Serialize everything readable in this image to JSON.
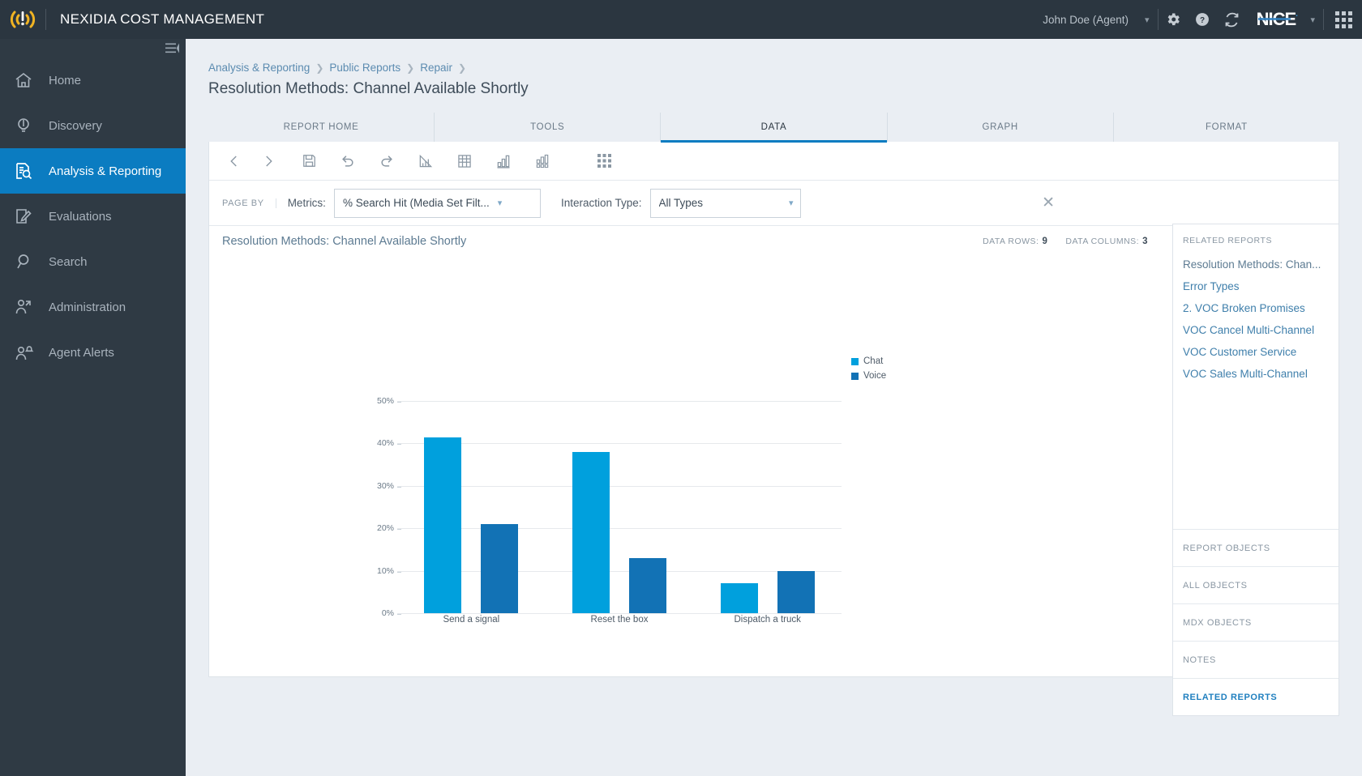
{
  "header": {
    "app_title": "NEXIDIA COST MANAGEMENT",
    "logo_icon": "signal-alert-icon",
    "user": "John Doe (Agent)",
    "user_chevron_icon": "chevron-down-icon",
    "settings_icon": "gear-icon",
    "help_icon": "question-circle-icon",
    "refresh_icon": "refresh-icon",
    "brand": "NICE",
    "brand_dot": "·",
    "brand_chevron_icon": "chevron-down-icon",
    "apps_icon": "waffle-grid-icon"
  },
  "sidebar": {
    "collapse_icon": "collapse-panel-icon",
    "items": [
      {
        "label": "Home",
        "icon": "home-icon",
        "active": false
      },
      {
        "label": "Discovery",
        "icon": "lightbulb-icon",
        "active": false
      },
      {
        "label": "Analysis & Reporting",
        "icon": "document-search-icon",
        "active": true
      },
      {
        "label": "Evaluations",
        "icon": "document-pencil-icon",
        "active": false
      },
      {
        "label": "Search",
        "icon": "magnifier-icon",
        "active": false
      },
      {
        "label": "Administration",
        "icon": "user-settings-icon",
        "active": false
      },
      {
        "label": "Agent Alerts",
        "icon": "user-bell-icon",
        "active": false
      }
    ]
  },
  "breadcrumb": [
    "Analysis & Reporting",
    "Public Reports",
    "Repair"
  ],
  "page_title": "Resolution Methods: Channel Available Shortly",
  "tabs": [
    {
      "label": "REPORT HOME",
      "active": false
    },
    {
      "label": "TOOLS",
      "active": false
    },
    {
      "label": "DATA",
      "active": true
    },
    {
      "label": "GRAPH",
      "active": false
    },
    {
      "label": "FORMAT",
      "active": false
    }
  ],
  "toolbar": {
    "icons": [
      "back-arrow-icon",
      "forward-arrow-icon",
      "save-floppy-icon",
      "undo-icon",
      "redo-icon",
      "area-chart-icon",
      "grid-table-icon",
      "bar-chart-icon",
      "grid-chart-icon",
      "apps-grid-icon"
    ]
  },
  "filters": {
    "page_by_label": "PAGE BY",
    "metrics_label": "Metrics:",
    "metrics_value": "% Search Hit (Media Set Filt...",
    "interaction_label": "Interaction Type:",
    "interaction_value": "All Types",
    "dropdown_icon": "chevron-down-icon",
    "close_icon": "close-icon",
    "close_label": "✕"
  },
  "report": {
    "title": "Resolution Methods: Channel Available Shortly",
    "data_rows_label": "DATA ROWS:",
    "data_rows_value": "9",
    "data_columns_label": "DATA COLUMNS:",
    "data_columns_value": "3"
  },
  "right_panel": {
    "related_reports_heading": "RELATED REPORTS",
    "links": [
      {
        "label": "Resolution Methods: Chan...",
        "muted": true
      },
      {
        "label": "Error Types",
        "muted": false
      },
      {
        "label": "2. VOC Broken Promises",
        "muted": false
      },
      {
        "label": "VOC Cancel Multi-Channel",
        "muted": false
      },
      {
        "label": "VOC Customer Service",
        "muted": false
      },
      {
        "label": "VOC Sales Multi-Channel",
        "muted": false
      }
    ],
    "sections": [
      {
        "label": "REPORT OBJECTS",
        "selected": false
      },
      {
        "label": "ALL OBJECTS",
        "selected": false
      },
      {
        "label": "MDX OBJECTS",
        "selected": false
      },
      {
        "label": "NOTES",
        "selected": false
      },
      {
        "label": "RELATED REPORTS",
        "selected": true
      }
    ]
  },
  "colors": {
    "accent": "#0b7cc1",
    "chat": "#00a0dd",
    "voice": "#1272b5",
    "topbar": "#2b3640",
    "sidebar": "#2f3a44",
    "link": "#3f7fab"
  },
  "chart_data": {
    "type": "bar",
    "title": "Resolution Methods: Channel Available Shortly",
    "xlabel": "",
    "ylabel": "",
    "ylim": [
      0,
      50
    ],
    "ytick_labels": [
      "0%",
      "10%",
      "20%",
      "30%",
      "40%",
      "50%"
    ],
    "ytick_values": [
      0,
      10,
      20,
      30,
      40,
      50
    ],
    "grid": true,
    "legend_position": "right",
    "categories": [
      "Send a signal",
      "Reset the box",
      "Dispatch a truck"
    ],
    "series": [
      {
        "name": "Chat",
        "color": "#00a0dd",
        "values": [
          41.5,
          38.0,
          7.0
        ]
      },
      {
        "name": "Voice",
        "color": "#1272b5",
        "values": [
          21.0,
          13.0,
          10.0
        ]
      }
    ]
  }
}
